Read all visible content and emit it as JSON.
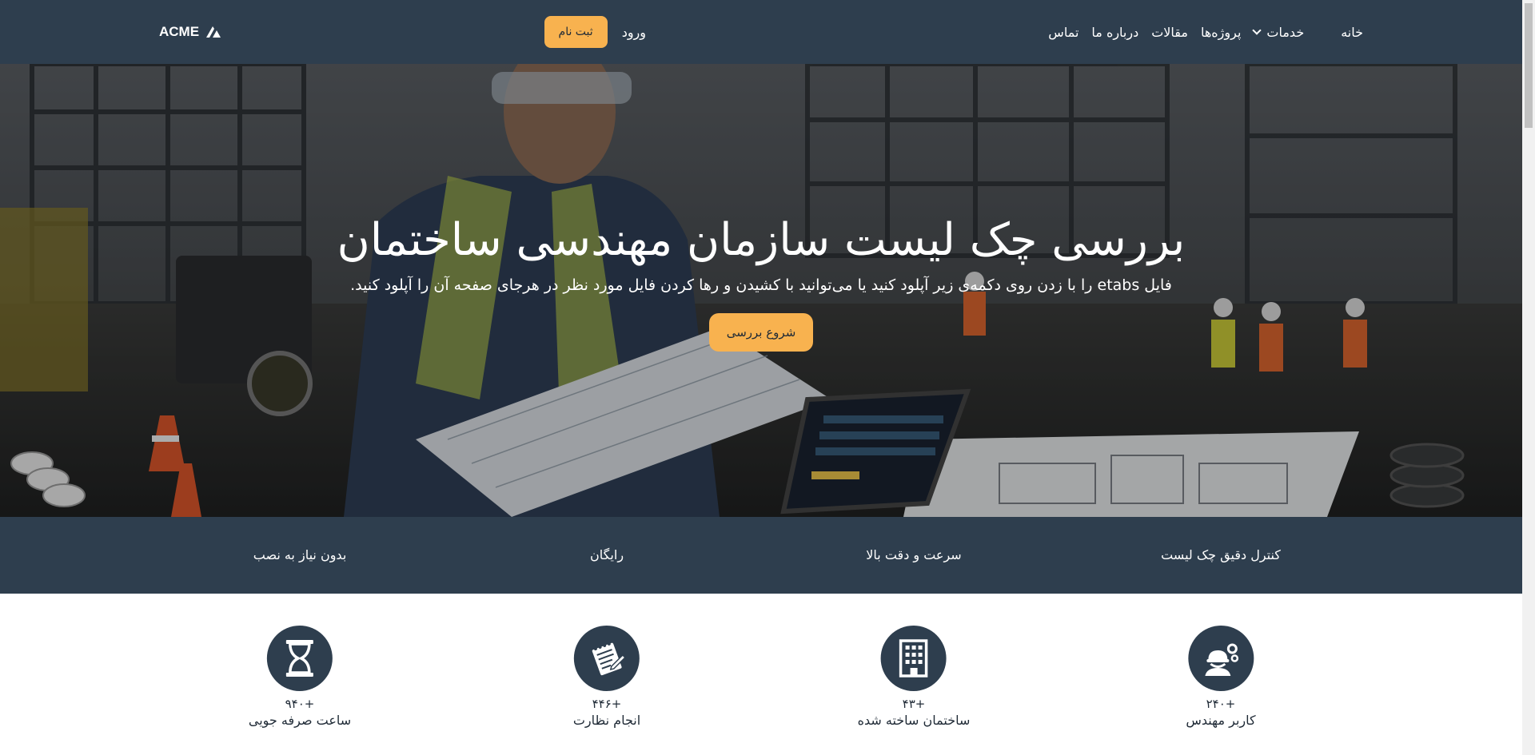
{
  "nav": {
    "brand": "ACME",
    "links": [
      "خانه",
      "خدمات",
      "پروژه‌ها",
      "مقالات",
      "درباره ما",
      "تماس"
    ],
    "login": "ورود",
    "signup": "ثبت نام"
  },
  "hero": {
    "title": "بررسی چک لیست سازمان مهندسی ساختمان",
    "subtitle": "فایل etabs را با زدن روی دکمه‌ی زیر آپلود کنید یا می‌توانید با کشیدن و رها کردن فایل مورد نظر در هرجای صفحه آن را آپلود کنید.",
    "cta": "شروع بررسی"
  },
  "features": [
    "کنترل دقیق چک لیست",
    "سرعت و دقت بالا",
    "رایگان",
    "بدون نیاز به نصب"
  ],
  "stats": [
    {
      "value": "+۲۴۰",
      "label": "کاربر مهندس",
      "icon": "engineer-icon"
    },
    {
      "value": "+۴۳",
      "label": "ساختمان ساخته شده",
      "icon": "building-icon"
    },
    {
      "value": "+۴۴۶",
      "label": "انجام نظارت",
      "icon": "notepad-icon"
    },
    {
      "value": "+۹۴۰",
      "label": "ساعت صرفه جویی",
      "icon": "hourglass-icon"
    }
  ],
  "colors": {
    "navy": "#2e3e4e",
    "accent": "#f8b24f"
  }
}
